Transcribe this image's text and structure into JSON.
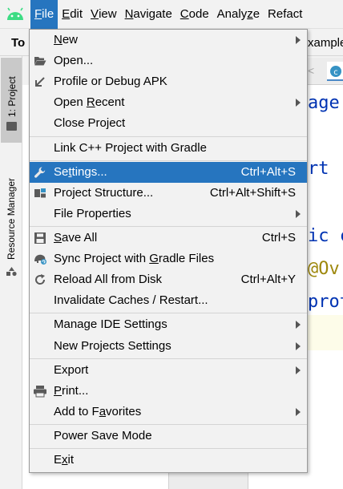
{
  "menubar": {
    "items": [
      {
        "mnemonic": "F",
        "rest": "ile"
      },
      {
        "mnemonic": "E",
        "rest": "dit"
      },
      {
        "mnemonic": "V",
        "rest": "iew"
      },
      {
        "mnemonic": "N",
        "rest": "avigate"
      },
      {
        "mnemonic": "C",
        "rest": "ode"
      },
      {
        "pre": "Analy",
        "mnemonic": "z",
        "rest": "e"
      },
      {
        "pre": "Refact",
        "mnemonic": "",
        "rest": ""
      }
    ]
  },
  "toolbar": {
    "left_text": "To",
    "right_text": "xample"
  },
  "sidebar": {
    "project_tab": "1: Project",
    "resource_tab": "Resource Manager"
  },
  "editor": {
    "lines": [
      {
        "text": "age"
      },
      {
        "text": "rt "
      },
      {
        "text": "ic c"
      },
      {
        "text": "@Ov"
      },
      {
        "text": "prot"
      }
    ]
  },
  "file_menu": {
    "new": {
      "pre": "",
      "mnemonic": "N",
      "rest": "ew"
    },
    "open": {
      "pre": "",
      "mnemonic": "",
      "rest": "Open..."
    },
    "profile": {
      "pre": "",
      "mnemonic": "",
      "rest": "Profile or Debug APK"
    },
    "open_recent": {
      "pre": "Open ",
      "mnemonic": "R",
      "rest": "ecent"
    },
    "close_project": {
      "pre": "",
      "mnemonic": "",
      "rest": "Close Project"
    },
    "link_cpp": {
      "pre": "",
      "mnemonic": "",
      "rest": "Link C++ Project with Gradle"
    },
    "settings": {
      "pre": "Se",
      "mnemonic": "t",
      "rest": "tings...",
      "shortcut": "Ctrl+Alt+S"
    },
    "project_structure": {
      "pre": "",
      "mnemonic": "",
      "rest": "Project Structure...",
      "shortcut": "Ctrl+Alt+Shift+S"
    },
    "file_properties": {
      "pre": "",
      "mnemonic": "",
      "rest": "File Properties"
    },
    "save_all": {
      "pre": "",
      "mnemonic": "S",
      "rest": "ave All",
      "shortcut": "Ctrl+S"
    },
    "sync": {
      "pre": "Sync Project with ",
      "mnemonic": "G",
      "rest": "radle Files"
    },
    "reload": {
      "pre": "",
      "mnemonic": "",
      "rest": "Reload All from Disk",
      "shortcut": "Ctrl+Alt+Y"
    },
    "invalidate": {
      "pre": "",
      "mnemonic": "",
      "rest": "Invalidate Caches / Restart..."
    },
    "manage_ide": {
      "pre": "",
      "mnemonic": "",
      "rest": "Manage IDE Settings"
    },
    "new_projects": {
      "pre": "",
      "mnemonic": "",
      "rest": "New Projects Settings"
    },
    "export": {
      "pre": "",
      "mnemonic": "",
      "rest": "Export"
    },
    "print": {
      "pre": "",
      "mnemonic": "P",
      "rest": "rint..."
    },
    "favorites": {
      "pre": "Add to F",
      "mnemonic": "a",
      "rest": "vorites"
    },
    "power_save": {
      "pre": "",
      "mnemonic": "",
      "rest": "Power Save Mode"
    },
    "exit": {
      "pre": "E",
      "mnemonic": "x",
      "rest": "it"
    }
  },
  "colors": {
    "selection": "#2675bf",
    "menu_bg": "#f2f2f2",
    "editor_keyword": "#0033b3",
    "annotation": "#9e880d"
  },
  "icons": {
    "logo": "android-icon",
    "open": "folder-open-icon",
    "profile": "arrow-down-left-icon",
    "settings": "wrench-icon",
    "project_structure": "project-structure-icon",
    "save_all": "save-icon",
    "sync": "sync-elephant-icon",
    "reload": "reload-icon",
    "print": "printer-icon"
  }
}
